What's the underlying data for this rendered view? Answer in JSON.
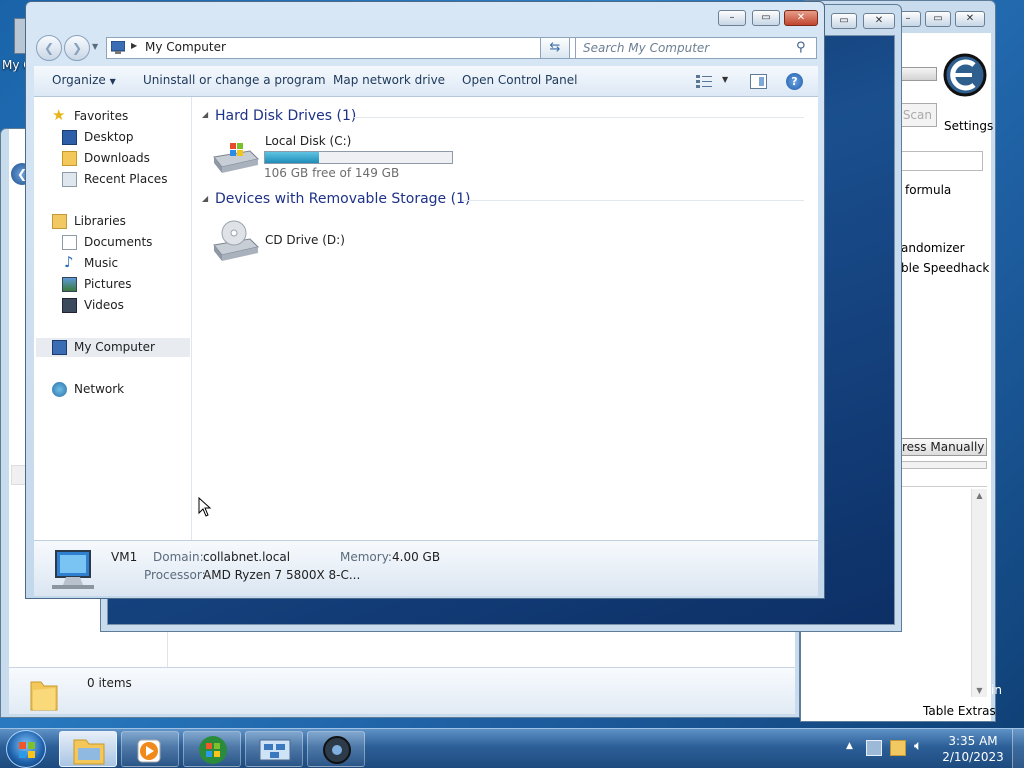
{
  "desktop": {
    "icon_label": "My C"
  },
  "cheat_engine": {
    "scan_button": "Scan",
    "settings_label": "Settings",
    "formula_text": "formula",
    "randomizer_text": "andomizer",
    "speedhack_text": "ble Speedhack",
    "add_address_button": "ress Manually",
    "table_extras": "Table Extras",
    "admin_text": "in"
  },
  "bg_explorer": {
    "status_items": "0 items"
  },
  "explorer": {
    "address_crumb": "My Computer",
    "search_placeholder": "Search My Computer",
    "toolbar": {
      "organize": "Organize",
      "uninstall": "Uninstall or change a program",
      "map_drive": "Map network drive",
      "control_panel": "Open Control Panel"
    },
    "nav": {
      "favorites": "Favorites",
      "desktop": "Desktop",
      "downloads": "Downloads",
      "recent": "Recent Places",
      "libraries": "Libraries",
      "documents": "Documents",
      "music": "Music",
      "pictures": "Pictures",
      "videos": "Videos",
      "my_computer": "My Computer",
      "network": "Network"
    },
    "groups": {
      "hard_disks": "Hard Disk Drives (1)",
      "removable": "Devices with Removable Storage (1)"
    },
    "drives": {
      "c_name": "Local Disk (C:)",
      "c_free": "106 GB free of 149 GB",
      "c_used_fraction": 0.289,
      "d_name": "CD Drive (D:)"
    },
    "details": {
      "computer_name": "VM1",
      "domain_label": "Domain:",
      "domain_value": "collabnet.local",
      "memory_label": "Memory:",
      "memory_value": "4.00 GB",
      "processor_label": "Processor:",
      "processor_value": "AMD Ryzen 7 5800X 8-C..."
    }
  },
  "taskbar": {
    "time": "3:35 AM",
    "date": "2/10/2023"
  },
  "colors": {
    "drive_bar": "#2aa1c9",
    "group_header": "#1e3287",
    "close_button": "#c0452f"
  }
}
